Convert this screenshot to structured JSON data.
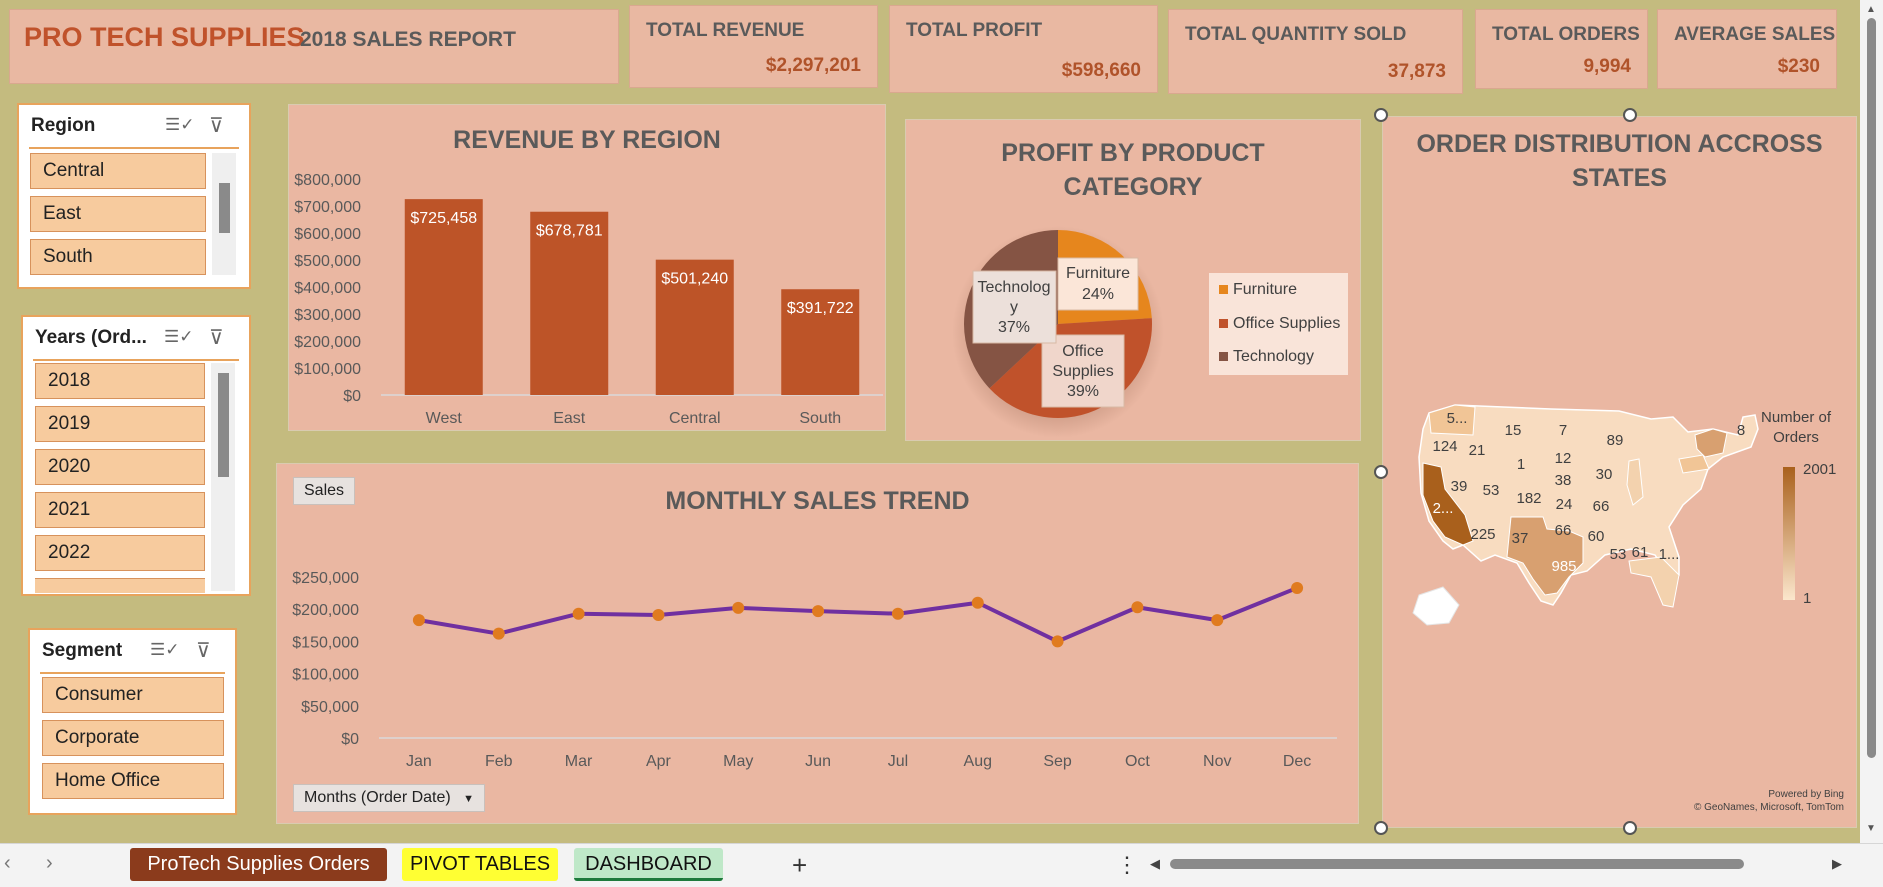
{
  "header": {
    "brand": "PRO TECH SUPPLIES",
    "report": "2018 SALES REPORT"
  },
  "kpis": [
    {
      "title": "TOTAL REVENUE",
      "value": "$2,297,201"
    },
    {
      "title": "TOTAL PROFIT",
      "value": "$598,660"
    },
    {
      "title": "TOTAL QUANTITY SOLD",
      "value": "37,873"
    },
    {
      "title": "TOTAL ORDERS",
      "value": "9,994"
    },
    {
      "title": "AVERAGE SALES",
      "value": "$230"
    }
  ],
  "slicers": {
    "region": {
      "title": "Region",
      "items": [
        "Central",
        "East",
        "South"
      ]
    },
    "years": {
      "title": "Years (Ord...",
      "items": [
        "2018",
        "2019",
        "2020",
        "2021",
        "2022"
      ]
    },
    "segment": {
      "title": "Segment",
      "items": [
        "Consumer",
        "Corporate",
        "Home Office"
      ]
    }
  },
  "icons": {
    "multiselect": "multi-select-icon",
    "clear_filter": "clear-filter-icon"
  },
  "charts": {
    "revenue": {
      "title": "REVENUE BY REGION",
      "value_labels": [
        "$725,458",
        "$678,781",
        "$501,240",
        "$391,722"
      ],
      "y_ticks": [
        "$800,000",
        "$700,000",
        "$600,000",
        "$500,000",
        "$400,000",
        "$300,000",
        "$200,000",
        "$100,000",
        "$0"
      ]
    },
    "profit": {
      "title_line1": "PROFIT BY PRODUCT",
      "title_line2": "CATEGORY",
      "labels": {
        "furniture_name": "Furniture",
        "furniture_pct": "24%",
        "office_name1": "Office",
        "office_name2": "Supplies",
        "office_pct": "39%",
        "tech_name1": "Technolog",
        "tech_name2": "y",
        "tech_pct": "37%"
      },
      "legend": [
        "Furniture",
        "Office Supplies",
        "Technology"
      ]
    },
    "monthly": {
      "title": "MONTHLY SALES TREND",
      "field_button": "Sales",
      "axis_button": "Months (Order Date)",
      "y_ticks": [
        "$250,000",
        "$200,000",
        "$150,000",
        "$100,000",
        "$50,000",
        "$0"
      ]
    },
    "map": {
      "title_line1": "ORDER DISTRIBUTION ACCROSS",
      "title_line2": "STATES",
      "legend_title1": "Number of",
      "legend_title2": "Orders",
      "legend_max": "2001",
      "legend_min": "1",
      "labels": [
        "5...",
        "15",
        "7",
        "89",
        "8",
        "124",
        "21",
        "1",
        "12",
        "39",
        "53",
        "182",
        "38",
        "30",
        "2...",
        "24",
        "66",
        "225",
        "37",
        "66",
        "60",
        "985",
        "53",
        "61",
        "1..."
      ],
      "powered": "Powered by Bing",
      "attribution": "© GeoNames, Microsoft, TomTom"
    }
  },
  "tabs": [
    "ProTech Supplies Orders",
    "PIVOT TABLES",
    "DASHBOARD"
  ],
  "add_sheet": "+",
  "colors": {
    "bar": "#bd5428",
    "line": "#7030a0",
    "marker": "#e07b1f",
    "furniture": "#e6861d",
    "office": "#c0522b",
    "technology": "#855444"
  },
  "chart_data": [
    {
      "type": "bar",
      "title": "REVENUE BY REGION",
      "categories": [
        "West",
        "East",
        "Central",
        "South"
      ],
      "values": [
        725458,
        678781,
        501240,
        391722
      ],
      "ylim": [
        0,
        800000
      ]
    },
    {
      "type": "pie",
      "title": "PROFIT BY PRODUCT CATEGORY",
      "categories": [
        "Furniture",
        "Office Supplies",
        "Technology"
      ],
      "values": [
        24,
        39,
        37
      ]
    },
    {
      "type": "line",
      "title": "MONTHLY SALES TREND",
      "categories": [
        "Jan",
        "Feb",
        "Mar",
        "Apr",
        "May",
        "Jun",
        "Jul",
        "Aug",
        "Sep",
        "Oct",
        "Nov",
        "Dec"
      ],
      "series": [
        {
          "name": "Sales",
          "values": [
            183000,
            162000,
            193000,
            191000,
            202000,
            197000,
            193000,
            210000,
            150000,
            203000,
            183000,
            233000
          ]
        }
      ],
      "ylim": [
        0,
        250000
      ]
    }
  ]
}
